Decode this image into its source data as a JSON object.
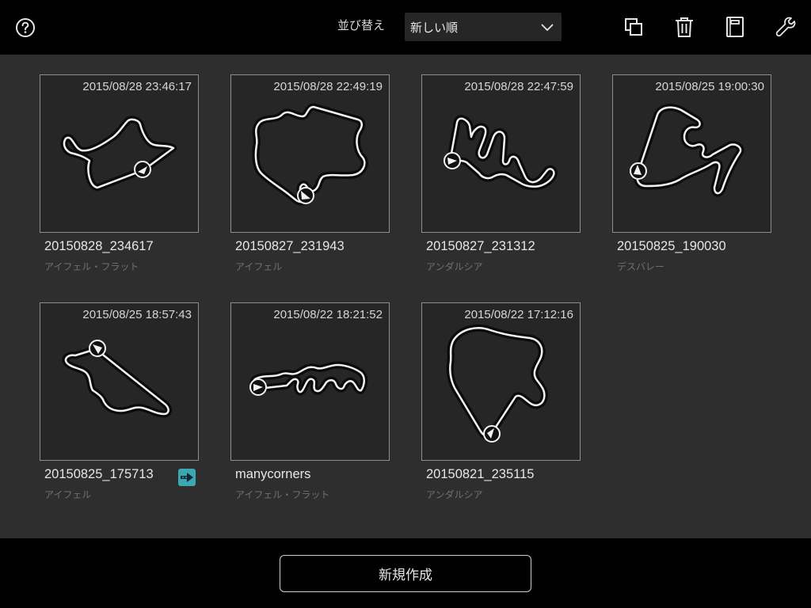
{
  "header": {
    "sort_label": "並び替え",
    "sort_value": "新しい順"
  },
  "icons": {
    "help": "help-icon",
    "copy": "copy-icon",
    "delete": "trash-icon",
    "notebook": "notebook-icon",
    "settings": "wrench-icon",
    "share": "share-icon"
  },
  "colors": {
    "accent_badge": "#3aa7b3",
    "grid_background": "#2e2e2e",
    "thumb_background": "#262626"
  },
  "sessions": [
    {
      "date": "2015/08/28 23:46:17",
      "name": "20150828_234617",
      "course": "アイフェル・フラット"
    },
    {
      "date": "2015/08/28 22:49:19",
      "name": "20150827_231943",
      "course": "アイフェル"
    },
    {
      "date": "2015/08/28 22:47:59",
      "name": "20150827_231312",
      "course": "アンダルシア"
    },
    {
      "date": "2015/08/25 19:00:30",
      "name": "20150825_190030",
      "course": "デスバレー"
    },
    {
      "date": "2015/08/25 18:57:43",
      "name": "20150825_175713",
      "course": "アイフェル",
      "shared": true
    },
    {
      "date": "2015/08/22 18:21:52",
      "name": "manycorners",
      "course": "アイフェル・フラット"
    },
    {
      "date": "2015/08/22 17:12:16",
      "name": "20150821_235115",
      "course": "アンダルシア"
    }
  ],
  "footer": {
    "new_button": "新規作成"
  }
}
